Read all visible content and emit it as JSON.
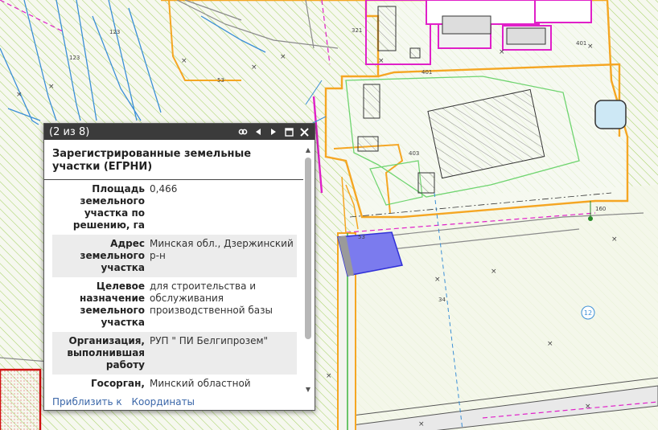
{
  "map": {
    "parcel_labels": [
      "321",
      "401",
      "53",
      "401",
      "53",
      "403",
      "123",
      "123",
      "53",
      "34",
      "160"
    ],
    "circle_number": "12"
  },
  "popup": {
    "counter": "(2 из 8)",
    "header": "Зарегистрированные земельные участки (ЕГРНИ)",
    "rows": [
      {
        "field": "Площадь земельного участка по решению, га",
        "value": "0,466"
      },
      {
        "field": "Адрес земельного участка",
        "value": "Минская обл., Дзержинский р-н"
      },
      {
        "field": "Целевое назначение земельного участка",
        "value": "для строительства и обслуживания производственной базы"
      },
      {
        "field": "Организация, выполнившая работу",
        "value": "РУП \" ПИ Белгипрозем\""
      },
      {
        "field": "Госорган, принявший",
        "value": "Минский областной исполнительный комитет"
      }
    ],
    "actions": {
      "zoom": "Приблизить к",
      "coords": "Координаты"
    }
  },
  "colors": {
    "hatch": "#a8d36a",
    "orange": "#f5a623",
    "magenta": "#e020c8",
    "parcel": "#7b7bee",
    "titlebar": "#3b3b3b",
    "link": "#3a66a8"
  },
  "icons": [
    "link-icon",
    "prev-icon",
    "next-icon",
    "maximize-icon",
    "close-icon"
  ]
}
